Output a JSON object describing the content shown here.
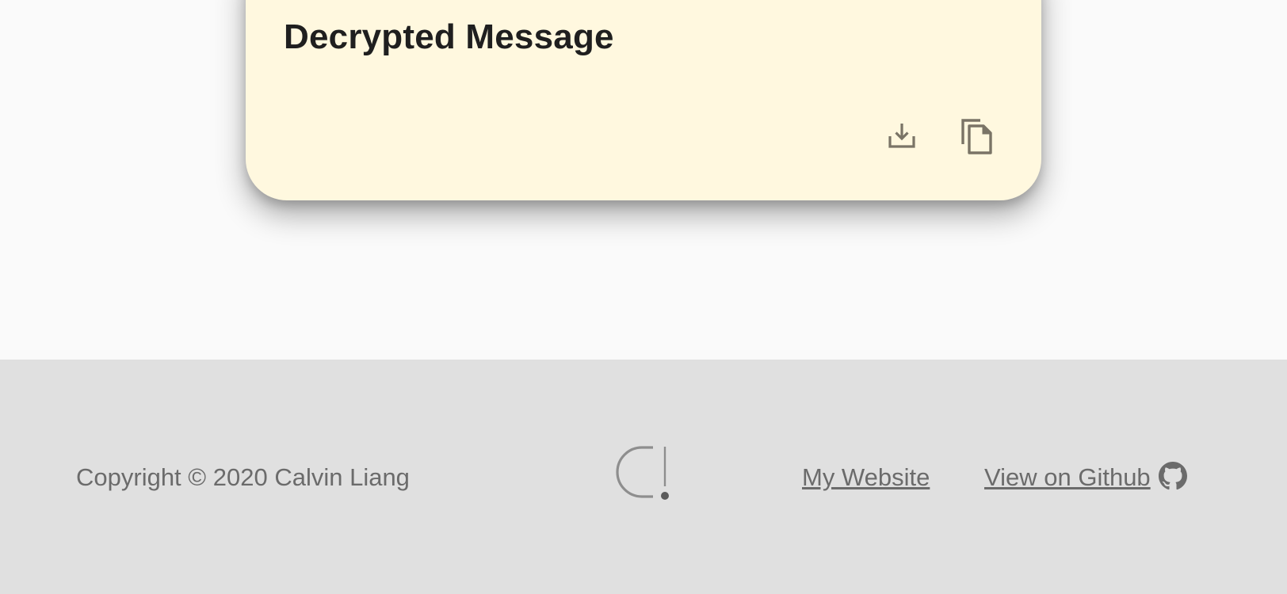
{
  "card": {
    "title": "Decrypted Message",
    "background_color": "#fff8df",
    "actions": [
      {
        "icon": "download-icon",
        "label": "Download"
      },
      {
        "icon": "copy-icon",
        "label": "Copy"
      }
    ]
  },
  "footer": {
    "background_color": "#e0e0e0",
    "copyright": "Copyright © 2020 Calvin Liang",
    "logo_icon": "logo-icon",
    "links": {
      "website": "My Website",
      "github": "View on Github ",
      "github_icon": "github-icon"
    }
  }
}
